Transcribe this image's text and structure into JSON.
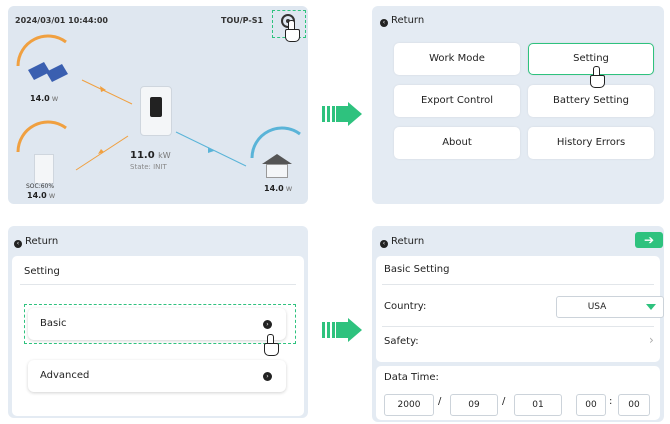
{
  "home": {
    "datetime": "2024/03/01 10:44:00",
    "mode": "TOU/P-S1",
    "solar_value": "14.0",
    "solar_unit": "w",
    "inverter_value": "11.0",
    "inverter_unit": "kW",
    "state": "State: INIT",
    "battery_soc": "SOC:60%",
    "battery_value": "14.0",
    "battery_unit": "w",
    "load_value": "14.0",
    "load_unit": "w"
  },
  "menu": {
    "return": "Return",
    "buttons": [
      "Work Mode",
      "Setting",
      "Export Control",
      "Battery Setting",
      "About",
      "History Errors"
    ]
  },
  "setting": {
    "return": "Return",
    "title": "Setting",
    "options": [
      "Basic",
      "Advanced"
    ]
  },
  "basic": {
    "return": "Return",
    "title": "Basic Setting",
    "country_label": "Country:",
    "country_value": "USA",
    "safety_label": "Safety:",
    "datetime_label": "Data Time:",
    "year": "2000",
    "month": "09",
    "day": "01",
    "hour": "00",
    "minute": "00",
    "date_sep": "/",
    "time_sep": ":"
  },
  "colors": {
    "accent": "#2ec27e",
    "flow_orange": "#f0a040",
    "flow_blue": "#5ab4d8"
  }
}
